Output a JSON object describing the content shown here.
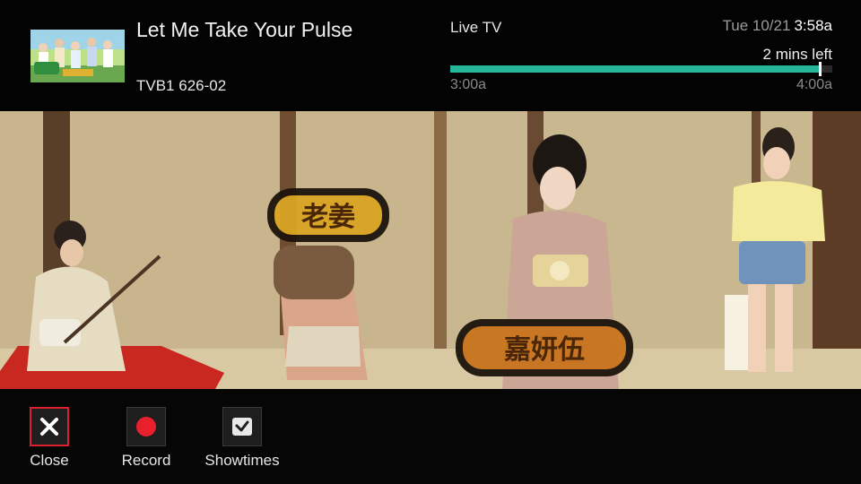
{
  "program": {
    "title": "Let Me Take Your Pulse",
    "channel": "TVB1 626-02",
    "thumbnail_icon": "show-poster-thumbnail"
  },
  "status": {
    "live_label": "Live TV",
    "date": "Tue 10/21",
    "time": "3:58a",
    "remaining": "2 mins left"
  },
  "progress": {
    "start": "3:00a",
    "end": "4:00a",
    "fraction": 0.967,
    "color": "#26b79a"
  },
  "video": {
    "scene_icon": "video-frame",
    "overlay_texts": [
      "老姜",
      "嘉妍伍"
    ]
  },
  "controls": [
    {
      "label": "Close",
      "icon": "close-icon",
      "selected": true
    },
    {
      "label": "Record",
      "icon": "record-icon",
      "selected": false
    },
    {
      "label": "Showtimes",
      "icon": "clock-icon",
      "selected": false
    }
  ],
  "colors": {
    "accent": "#26b79a",
    "selection": "#d8202e",
    "record": "#e8202c"
  }
}
